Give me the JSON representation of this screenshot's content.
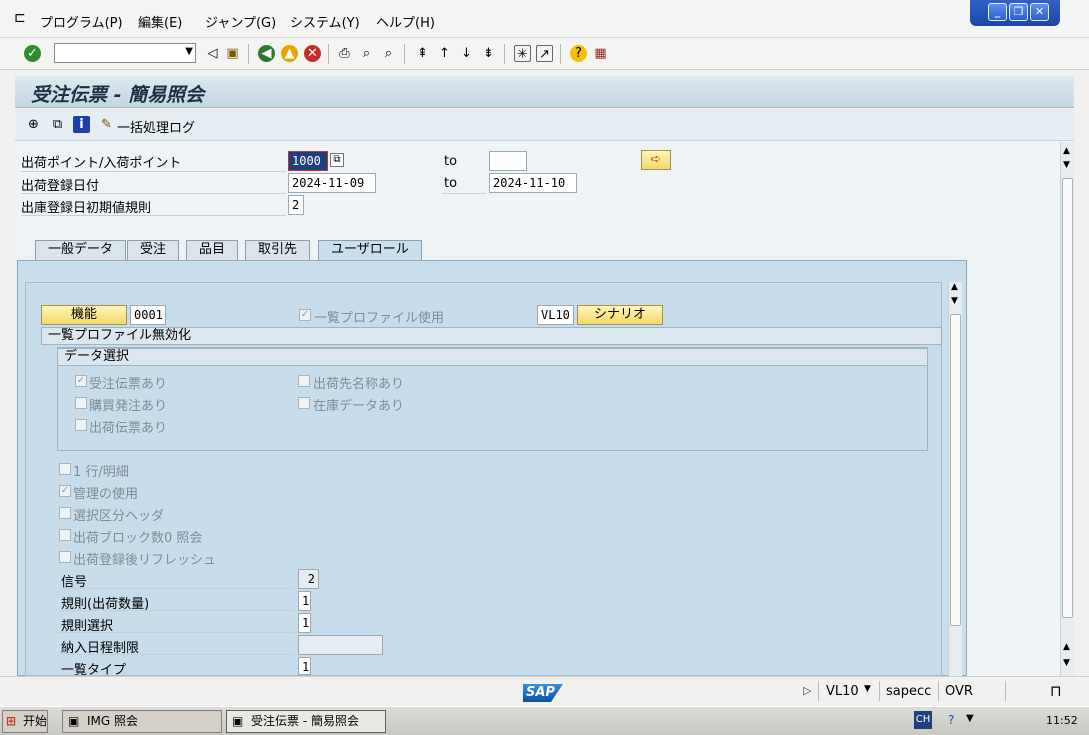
{
  "menu": [
    "プログラム(P)",
    "編集(E)",
    "ジャンプ(G)",
    "システム(Y)",
    "ヘルプ(H)"
  ],
  "title": "受注伝票 - 簡易照会",
  "app_toolbar": {
    "batch_log_label": "一括処理ログ"
  },
  "selection": {
    "shipping_point_label": "出荷ポイント/入荷ポイント",
    "shipping_point_value": "1000",
    "to_label_1": "to",
    "to_value_1": "",
    "ship_date_label": "出荷登録日付",
    "ship_date_from": "2024-11-09",
    "to_label_2": "to",
    "ship_date_to": "2024-11-10",
    "default_rule_label": "出庫登録日初期値規則",
    "default_rule_value": "2"
  },
  "tabs": [
    "一般データ",
    "受注",
    "品目",
    "取引先",
    "ユーザロール"
  ],
  "active_tab": "ユーザロール",
  "panel": {
    "function_button": "機能",
    "function_value": "0001",
    "list_profile_label": "一覧プロファイル使用",
    "scenario_code": "VL10",
    "scenario_button": "シナリオ",
    "disable_section": "一覧プロファイル無効化",
    "data_selection_title": "データ選択",
    "order_docs": "受注伝票あり",
    "ship_to_name": "出荷先名称あり",
    "purchase_orders": "購買発注あり",
    "stock_data": "在庫データあり",
    "delivery_docs": "出荷伝票あり",
    "one_line_item": "1 行/明細",
    "use_admin": "管理の使用",
    "selection_header": "選択区分ヘッダ",
    "block_count": "出荷ブロック数0 照会",
    "refresh_after": "出荷登録後リフレッシュ",
    "signal_label": "信号",
    "signal_value": "2",
    "rule_qty_label": "規則(出荷数量)",
    "rule_qty_value": "1",
    "rule_sel_label": "規則選択",
    "rule_sel_value": "1",
    "delivery_limit_label": "納入日程制限",
    "delivery_limit_value": "",
    "list_type_label": "一覧タイプ",
    "list_type_value": "1"
  },
  "status": {
    "logo": "SAP",
    "transaction": "VL10",
    "server": "sapecc",
    "mode": "OVR"
  },
  "taskbar": {
    "start": "开始",
    "task1": "IMG 照会",
    "task2": "受注伝票 - 簡易照会",
    "clock": "11:52"
  }
}
